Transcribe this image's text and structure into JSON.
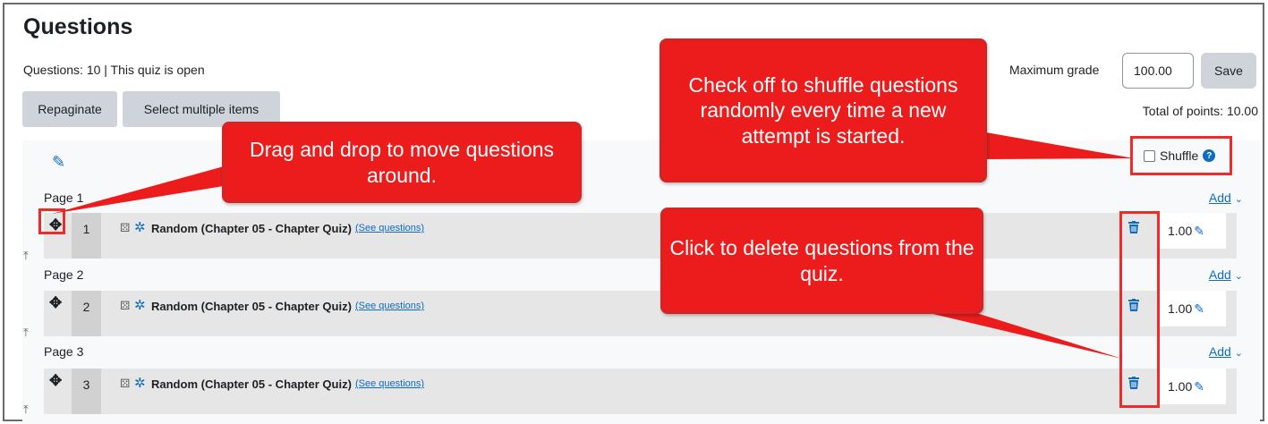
{
  "page": {
    "title": "Questions",
    "info": "Questions: 10 | This quiz is open"
  },
  "toolbar": {
    "repaginate_label": "Repaginate",
    "select_multiple_label": "Select multiple items"
  },
  "grading": {
    "max_grade_label": "Maximum grade",
    "max_grade_value": "100.00",
    "save_label": "Save",
    "total_points": "Total of points: 10.00"
  },
  "shuffle": {
    "label": "Shuffle",
    "checked": false,
    "help_icon": "question-circle-icon"
  },
  "pages": [
    {
      "label": "Page 1",
      "add_label": "Add",
      "question": {
        "number": "1",
        "name": "Random (Chapter 05 - Chapter Quiz)",
        "see_label": "(See questions)",
        "mark": "1.00"
      }
    },
    {
      "label": "Page 2",
      "add_label": "Add",
      "question": {
        "number": "2",
        "name": "Random (Chapter 05 - Chapter Quiz)",
        "see_label": "(See questions)",
        "mark": "1.00"
      }
    },
    {
      "label": "Page 3",
      "add_label": "Add",
      "question": {
        "number": "3",
        "name": "Random (Chapter 05 - Chapter Quiz)",
        "see_label": "(See questions)",
        "mark": "1.00"
      }
    }
  ],
  "callouts": {
    "shuffle": "Check off to shuffle questions randomly every time a new attempt is started.",
    "drag": "Drag and drop to move questions around.",
    "delete": "Click to delete questions from the quiz."
  },
  "colors": {
    "accent": "#0f6cbf",
    "callout": "#ec1c1c",
    "highlight": "#ee2b2b",
    "button_grey": "#ced4da"
  }
}
